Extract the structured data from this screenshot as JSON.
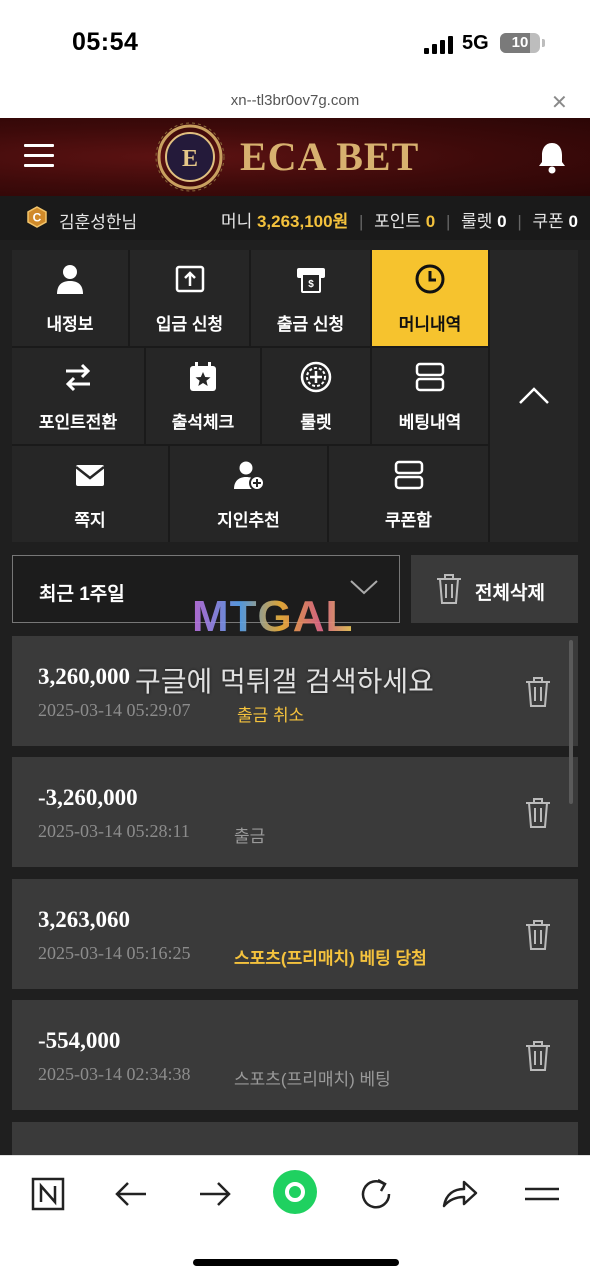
{
  "status_bar": {
    "time": "05:54",
    "network": "5G",
    "battery": "10"
  },
  "browser": {
    "url": "xn--tl3br0ov7g.com",
    "close_icon": "close-icon"
  },
  "header": {
    "brand": "ECA BET",
    "brand_color": "#d7b16f",
    "menu_icon": "hamburger-icon",
    "bell_icon": "bell-icon"
  },
  "user": {
    "name": "김훈성한님",
    "money_label": "머니",
    "money_value": "3,263,100원",
    "point_label": "포인트",
    "point_value": "0",
    "roulette_label": "룰렛",
    "roulette_value": "0",
    "coupon_label": "쿠폰",
    "coupon_value": "0"
  },
  "menu": {
    "items": [
      {
        "label": "내정보",
        "icon": "user-icon"
      },
      {
        "label": "입금 신청",
        "icon": "deposit-icon"
      },
      {
        "label": "출금 신청",
        "icon": "withdraw-icon"
      },
      {
        "label": "머니내역",
        "icon": "clock-icon",
        "active": true
      },
      {
        "label": "포인트전환",
        "icon": "exchange-arrows-icon"
      },
      {
        "label": "출석체크",
        "icon": "calendar-star-icon"
      },
      {
        "label": "룰렛",
        "icon": "roulette-icon"
      },
      {
        "label": "베팅내역",
        "icon": "list-icon"
      },
      {
        "label": "쪽지",
        "icon": "envelope-icon"
      },
      {
        "label": "지인추천",
        "icon": "user-add-icon"
      },
      {
        "label": "쿠폰함",
        "icon": "coupon-icon"
      }
    ],
    "accent_color": "#f6c32e"
  },
  "filter": {
    "period": "최근 1주일",
    "delete_all": "전체삭제"
  },
  "watermark": {
    "logo": "MTGAL",
    "text": "구글에 먹튀갤 검색하세요"
  },
  "transactions": [
    {
      "amount": "3,260,000",
      "date": "2025-03-14 05:29:07",
      "tag": "출금 취소",
      "tag_color": "#f4c23d"
    },
    {
      "amount": "-3,260,000",
      "date": "2025-03-14 05:28:11",
      "tag": "출금",
      "tag_color": "#9a9a9a"
    },
    {
      "amount": "3,263,060",
      "date": "2025-03-14 05:16:25",
      "tag": "스포츠(프리매치) 베팅 당첨",
      "tag_color": "#f4c23d"
    },
    {
      "amount": "-554,000",
      "date": "2025-03-14 02:34:38",
      "tag": "스포츠(프리매치) 베팅",
      "tag_color": "#9a9a9a"
    }
  ],
  "bottom_bar": {
    "icons": [
      "n-icon",
      "back-arrow-icon",
      "forward-arrow-icon",
      "home-circle-icon",
      "reload-icon",
      "share-icon",
      "menu-icon"
    ]
  }
}
